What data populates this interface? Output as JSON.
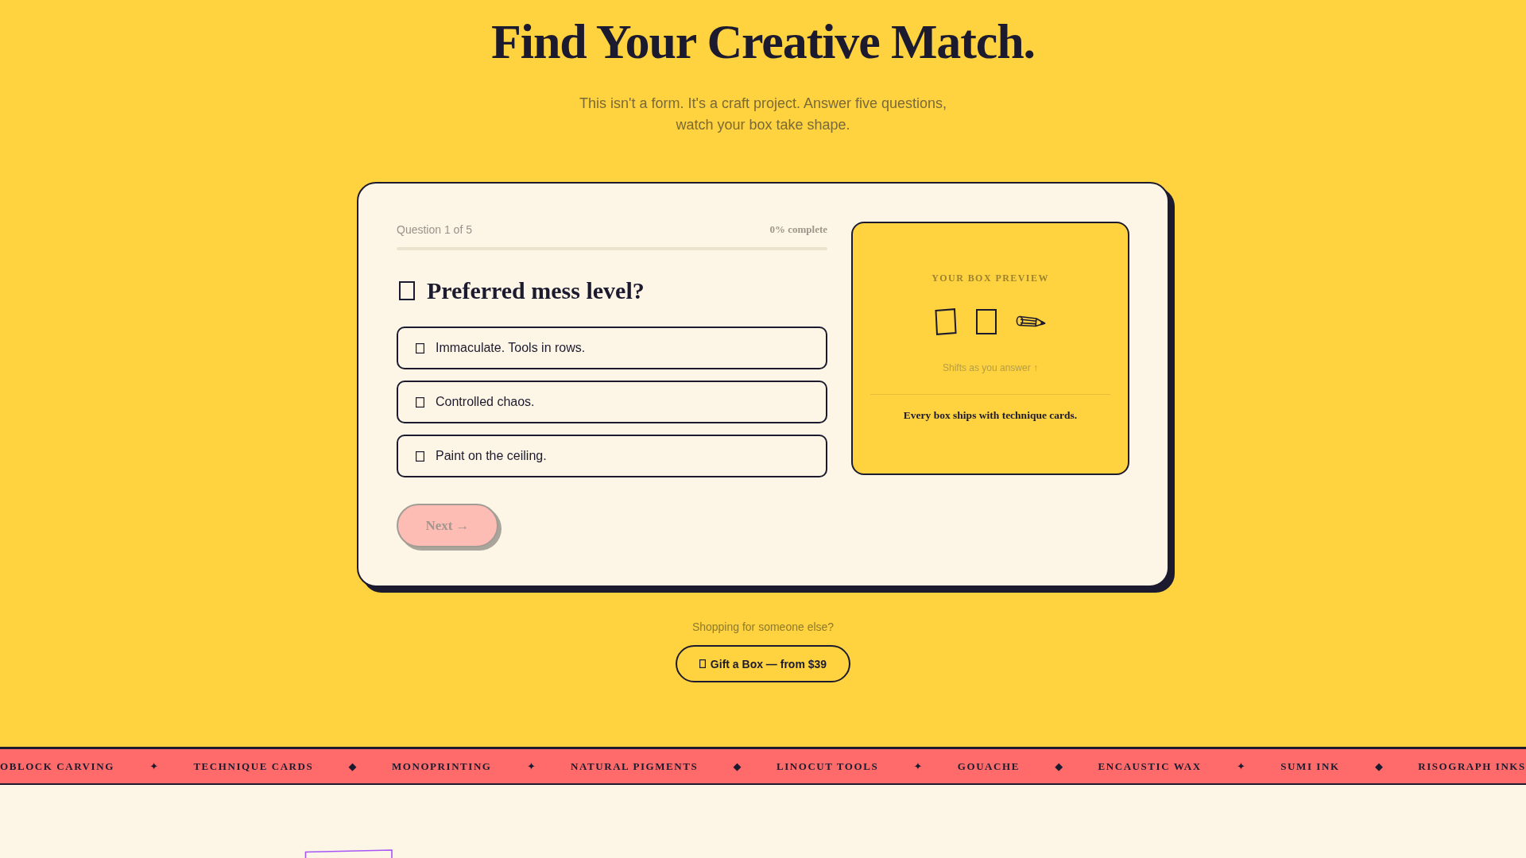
{
  "header": {
    "title": "Find Your Creative Match.",
    "subtitle": "This isn't a form. It's a craft project. Answer five questions, watch your box take shape."
  },
  "quiz": {
    "step": "Question 1 of 5",
    "percent": "0% complete",
    "progress": {
      "level": 0
    },
    "question": "Preferred mess level?",
    "options": [
      {
        "label": "Immaculate. Tools in rows.",
        "selected": false
      },
      {
        "label": "Controlled chaos.",
        "selected": false
      },
      {
        "label": "Paint on the ceiling.",
        "selected": false
      }
    ],
    "next_button": {
      "label": "Next →",
      "disabled": true
    }
  },
  "preview": {
    "title": "YOUR BOX PREVIEW",
    "caption": "Shifts as you answer ↑",
    "note": "Every box ships with technique cards."
  },
  "gift": {
    "prompt": "Shopping for someone else?",
    "button": "Gift a Box — from $39"
  },
  "ticker": [
    {
      "kind": "item",
      "text": "OBLOCK CARVING"
    },
    {
      "kind": "separator",
      "text": "✦"
    },
    {
      "kind": "item",
      "text": "TECHNIQUE CARDS"
    },
    {
      "kind": "separator",
      "text": "◆"
    },
    {
      "kind": "item",
      "text": "MONOPRINTING"
    },
    {
      "kind": "separator",
      "text": "✦"
    },
    {
      "kind": "item",
      "text": "NATURAL PIGMENTS"
    },
    {
      "kind": "separator",
      "text": "◆"
    },
    {
      "kind": "item",
      "text": "LINOCUT TOOLS"
    },
    {
      "kind": "separator",
      "text": "✦"
    },
    {
      "kind": "item",
      "text": "GOUACHE"
    },
    {
      "kind": "separator",
      "text": "◆"
    },
    {
      "kind": "item",
      "text": "ENCAUSTIC WAX"
    },
    {
      "kind": "separator",
      "text": "✦"
    },
    {
      "kind": "item",
      "text": "SUMI INK"
    },
    {
      "kind": "separator",
      "text": "◆"
    },
    {
      "kind": "item",
      "text": "RISOGRAPH INKS"
    }
  ]
}
